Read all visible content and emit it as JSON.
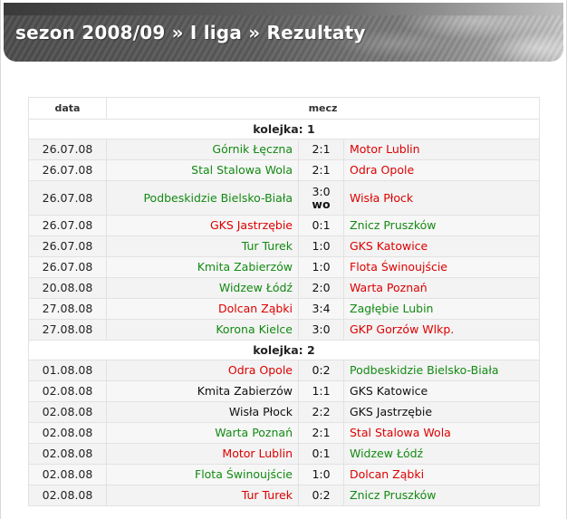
{
  "header": {
    "title": "sezon 2008/09 » I liga » Rezultaty"
  },
  "table": {
    "columns": [
      "data",
      "mecz"
    ],
    "rounds": [
      {
        "label": "kolejka: 1",
        "matches": [
          {
            "date": "26.07.08",
            "home": "Górnik Łęczna",
            "score": "2:1",
            "away": "Motor Lublin",
            "home_result": "win",
            "away_result": "loss"
          },
          {
            "date": "26.07.08",
            "home": "Stal Stalowa Wola",
            "score": "2:1",
            "away": "Odra Opole",
            "home_result": "win",
            "away_result": "loss"
          },
          {
            "date": "26.07.08",
            "home": "Podbeskidzie Bielsko-Biała",
            "score": "3:0",
            "note": "wo",
            "away": "Wisła Płock",
            "home_result": "win",
            "away_result": "loss"
          },
          {
            "date": "26.07.08",
            "home": "GKS Jastrzębie",
            "score": "0:1",
            "away": "Znicz Pruszków",
            "home_result": "loss",
            "away_result": "win"
          },
          {
            "date": "26.07.08",
            "home": "Tur Turek",
            "score": "1:0",
            "away": "GKS Katowice",
            "home_result": "win",
            "away_result": "loss"
          },
          {
            "date": "26.07.08",
            "home": "Kmita Zabierzów",
            "score": "1:0",
            "away": "Flota Świnoujście",
            "home_result": "win",
            "away_result": "loss"
          },
          {
            "date": "20.08.08",
            "home": "Widzew Łódź",
            "score": "2:0",
            "away": "Warta Poznań",
            "home_result": "win",
            "away_result": "loss"
          },
          {
            "date": "27.08.08",
            "home": "Dolcan Ząbki",
            "score": "3:4",
            "away": "Zagłębie Lubin",
            "home_result": "loss",
            "away_result": "win"
          },
          {
            "date": "27.08.08",
            "home": "Korona Kielce",
            "score": "3:0",
            "away": "GKP Gorzów Wlkp.",
            "home_result": "win",
            "away_result": "loss"
          }
        ]
      },
      {
        "label": "kolejka: 2",
        "matches": [
          {
            "date": "01.08.08",
            "home": "Odra Opole",
            "score": "0:2",
            "away": "Podbeskidzie Bielsko-Biała",
            "home_result": "loss",
            "away_result": "win"
          },
          {
            "date": "02.08.08",
            "home": "Kmita Zabierzów",
            "score": "1:1",
            "away": "GKS Katowice",
            "home_result": "draw",
            "away_result": "draw"
          },
          {
            "date": "02.08.08",
            "home": "Wisła Płock",
            "score": "2:2",
            "away": "GKS Jastrzębie",
            "home_result": "draw",
            "away_result": "draw"
          },
          {
            "date": "02.08.08",
            "home": "Warta Poznań",
            "score": "2:1",
            "away": "Stal Stalowa Wola",
            "home_result": "win",
            "away_result": "loss"
          },
          {
            "date": "02.08.08",
            "home": "Motor Lublin",
            "score": "0:1",
            "away": "Widzew Łódź",
            "home_result": "loss",
            "away_result": "win"
          },
          {
            "date": "02.08.08",
            "home": "Flota Świnoujście",
            "score": "1:0",
            "away": "Dolcan Ząbki",
            "home_result": "win",
            "away_result": "loss"
          },
          {
            "date": "02.08.08",
            "home": "Tur Turek",
            "score": "0:2",
            "away": "Znicz Pruszków",
            "home_result": "loss",
            "away_result": "win"
          }
        ]
      }
    ]
  },
  "colors": {
    "win": "#138a13",
    "loss": "#dd0000",
    "draw": "#111111"
  }
}
